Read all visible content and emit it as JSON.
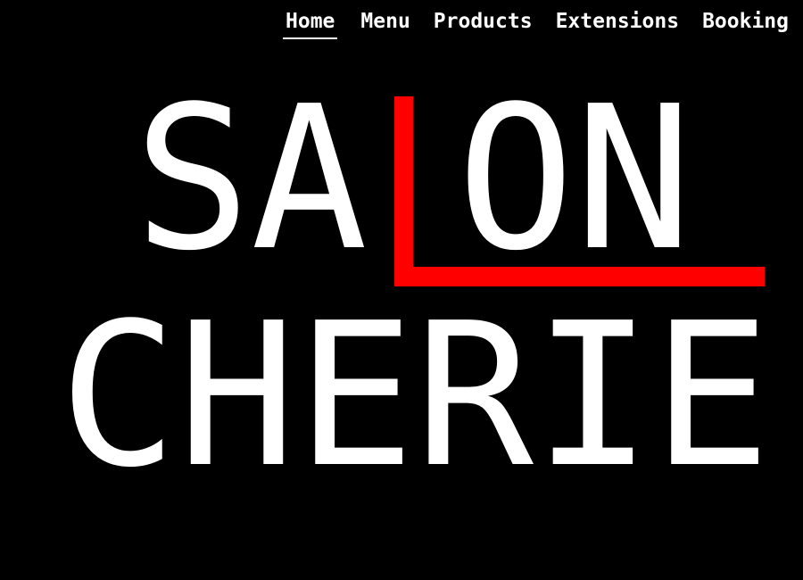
{
  "nav": {
    "items": [
      {
        "label": "Home",
        "active": true
      },
      {
        "label": "Menu",
        "active": false
      },
      {
        "label": "Products",
        "active": false
      },
      {
        "label": "Extensions",
        "active": false
      },
      {
        "label": "Booking",
        "active": false
      }
    ]
  },
  "logo": {
    "line1_part1": "SA",
    "line1_part2": "ON",
    "line2": "CHERIE",
    "accent_color": "#ff0000",
    "text_color": "#ffffff",
    "background_color": "#000000"
  }
}
